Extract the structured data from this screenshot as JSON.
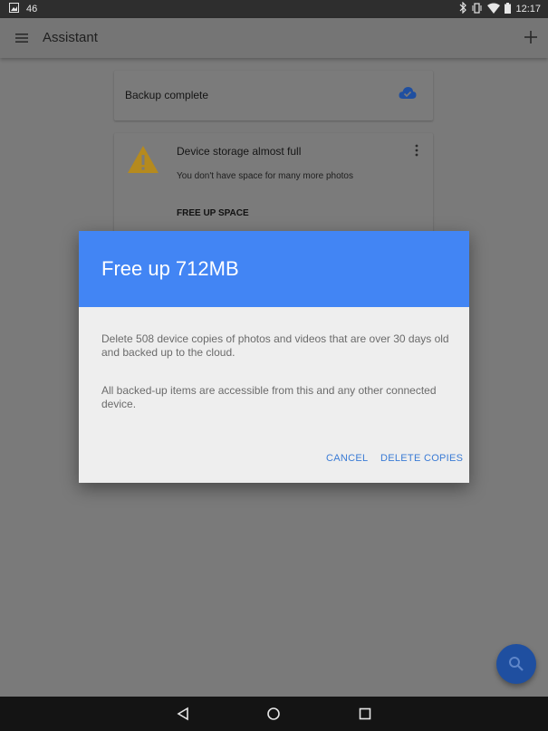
{
  "status_bar": {
    "notification_count": "46",
    "time": "12:17",
    "icons": [
      "image-icon",
      "bluetooth-icon",
      "vibrate-icon",
      "wifi-icon",
      "battery-icon"
    ]
  },
  "app_bar": {
    "title": "Assistant",
    "menu_icon": "hamburger-menu-icon",
    "action_icon": "add-icon"
  },
  "cards": {
    "backup": {
      "text": "Backup complete",
      "icon": "cloud-done-icon"
    },
    "storage": {
      "title": "Device storage almost full",
      "subtitle": "You don't have space for many more photos",
      "action": "FREE UP SPACE",
      "icon": "warning-icon"
    }
  },
  "dialog": {
    "title": "Free up 712MB",
    "body_1": "Delete 508 device copies of photos and videos that are over 30 days old and backed up to the cloud.",
    "body_2": "All backed-up items are accessible from this and any other connected device.",
    "cancel_label": "CANCEL",
    "confirm_label": "DELETE COPIES"
  },
  "fab": {
    "icon": "search-icon"
  },
  "nav_bar": {
    "icons": [
      "back-icon",
      "home-icon",
      "recents-icon"
    ]
  },
  "colors": {
    "dialog_header": "#4285f4",
    "dialog_button_text": "#3a7bd5",
    "fab": "#1f4fa0",
    "warning": "#b58a1e"
  }
}
